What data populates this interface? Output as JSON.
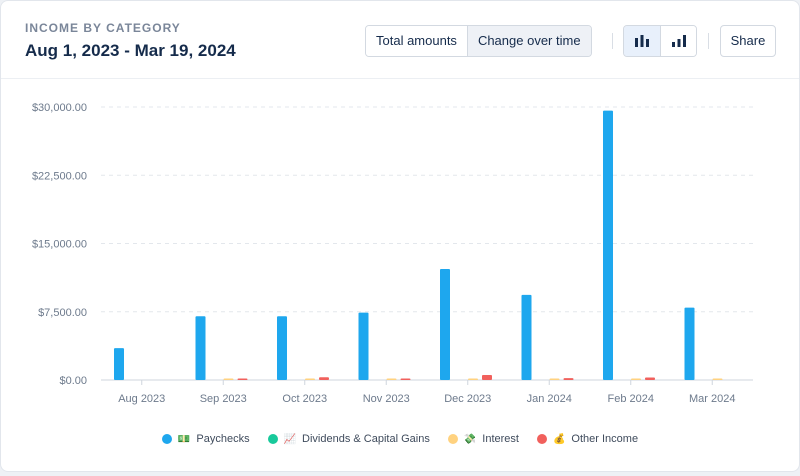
{
  "header": {
    "eyebrow": "INCOME BY CATEGORY",
    "date_range": "Aug 1, 2023 - Mar 19, 2024",
    "view_toggle": {
      "total_label": "Total amounts",
      "change_label": "Change over time",
      "selected": "change"
    },
    "chart_style": {
      "selected": "grouped-bars"
    },
    "share_label": "Share"
  },
  "legend": [
    {
      "emoji": "💵",
      "label": "Paychecks",
      "color": "#1ea7ee"
    },
    {
      "emoji": "📈",
      "label": "Dividends & Capital Gains",
      "color": "#18c99b"
    },
    {
      "emoji": "💸",
      "label": "Interest",
      "color": "#ffd27f"
    },
    {
      "emoji": "💰",
      "label": "Other Income",
      "color": "#f1605c"
    }
  ],
  "chart_data": {
    "type": "bar",
    "categories": [
      "Aug 2023",
      "Sep 2023",
      "Oct 2023",
      "Nov 2023",
      "Dec 2023",
      "Jan 2024",
      "Feb 2024",
      "Mar 2024"
    ],
    "series": [
      {
        "name": "Paychecks",
        "color": "#1ea7ee",
        "values": [
          3500,
          7000,
          7000,
          7400,
          12200,
          9350,
          29600,
          7950
        ]
      },
      {
        "name": "Dividends & Capital Gains",
        "color": "#18c99b",
        "values": [
          0,
          0,
          0,
          0,
          0,
          0,
          0,
          0
        ]
      },
      {
        "name": "Interest",
        "color": "#ffd27f",
        "values": [
          0,
          80,
          80,
          90,
          90,
          100,
          100,
          60
        ]
      },
      {
        "name": "Other Income",
        "color": "#f1605c",
        "values": [
          0,
          80,
          300,
          150,
          550,
          200,
          270,
          0
        ]
      }
    ],
    "yticks": [
      "$0.00",
      "$7,500.00",
      "$15,000.00",
      "$22,500.00",
      "$30,000.00"
    ],
    "ylim": [
      0,
      30000
    ],
    "grid": true
  }
}
